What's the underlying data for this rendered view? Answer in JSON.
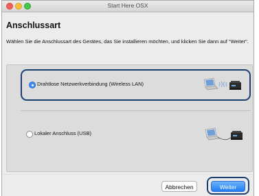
{
  "window": {
    "title": "Start Here OSX"
  },
  "heading": "Anschlussart",
  "description": "Wählen Sie die Anschlussart des Gerätes, das Sie installieren möchten, und klicken Sie dann auf \"Weiter\".",
  "options": [
    {
      "label": "Drahtlose Netzwerkverbindung (Wireless LAN)",
      "selected": true,
      "illustration": "laptop-wifi-printer-icon"
    },
    {
      "label": "Lokaler Anschluss (USB)",
      "selected": false,
      "illustration": "laptop-usb-printer-icon"
    }
  ],
  "buttons": {
    "cancel": "Abbrechen",
    "next": "Weiter"
  },
  "colors": {
    "highlight": "#1a3f6c",
    "accent": "#1f7ef3"
  }
}
